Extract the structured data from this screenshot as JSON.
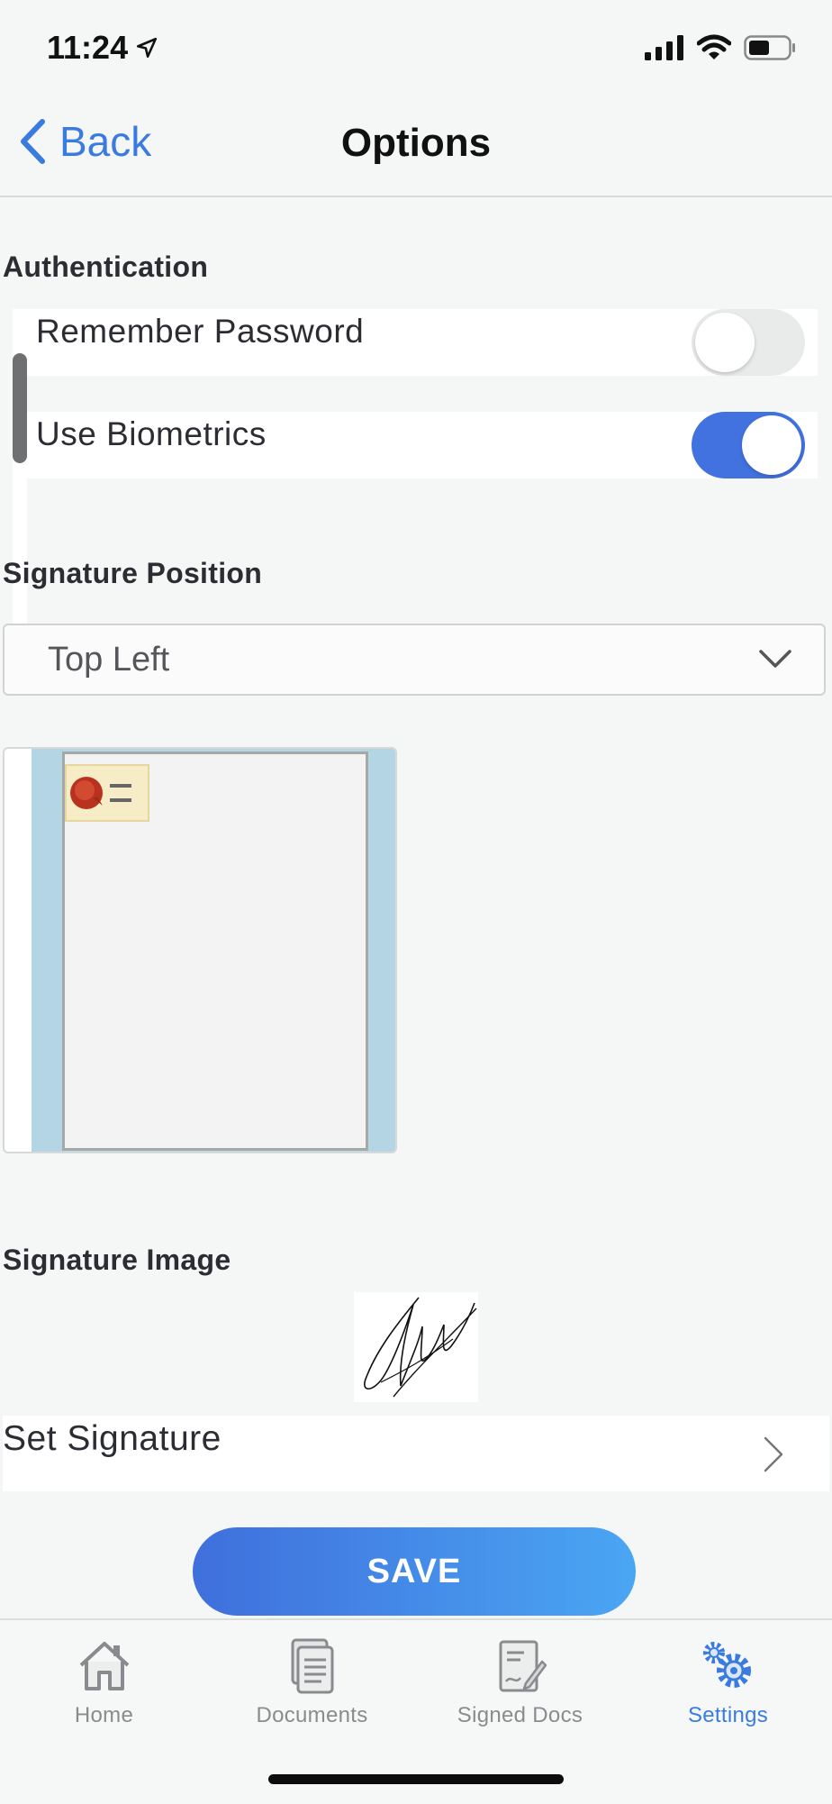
{
  "status_bar": {
    "time": "11:24"
  },
  "nav": {
    "back_label": "Back",
    "title": "Options"
  },
  "authentication": {
    "heading": "Authentication",
    "remember_password": {
      "label": "Remember Password",
      "enabled": false
    },
    "use_biometrics": {
      "label": "Use Biometrics",
      "enabled": true
    }
  },
  "signature_position": {
    "heading": "Signature Position",
    "selected": "Top Left"
  },
  "signature_image": {
    "heading": "Signature Image",
    "set_label": "Set Signature"
  },
  "save_label": "SAVE",
  "tabs": [
    {
      "label": "Home",
      "icon": "home-icon",
      "active": false
    },
    {
      "label": "Documents",
      "icon": "documents-icon",
      "active": false
    },
    {
      "label": "Signed Docs",
      "icon": "signed-docs-icon",
      "active": false
    },
    {
      "label": "Settings",
      "icon": "settings-icon",
      "active": true
    }
  ],
  "colors": {
    "accent": "#3a7be0",
    "toggle_on": "#4272e0",
    "save_start": "#3f6fdc",
    "save_end": "#4aa6f3"
  }
}
